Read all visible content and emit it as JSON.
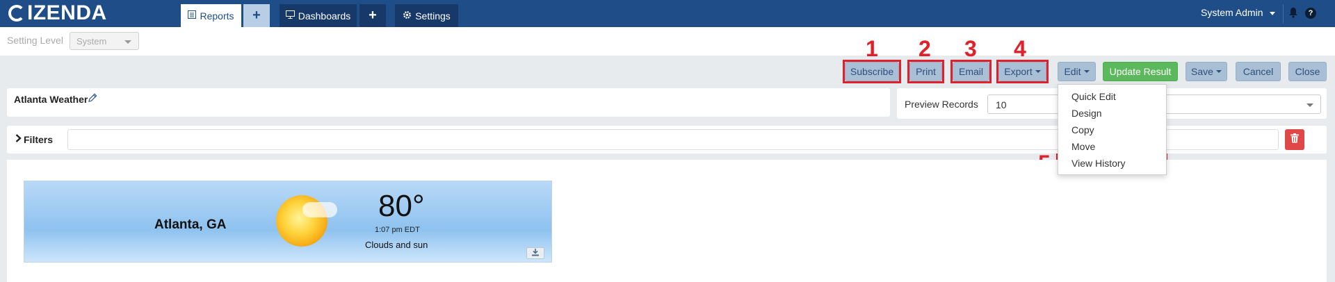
{
  "brand": {
    "logo_text": "IZENDA"
  },
  "nav": {
    "reports_label": "Reports",
    "dashboards_label": "Dashboards",
    "settings_label": "Settings",
    "plus_glyph": "+",
    "user_name": "System Admin",
    "help_glyph": "?"
  },
  "setting_level": {
    "label": "Setting Level",
    "value": "System"
  },
  "toolbar": {
    "subscribe": "Subscribe",
    "print": "Print",
    "email": "Email",
    "export": "Export",
    "edit": "Edit",
    "update_result": "Update Result",
    "save": "Save",
    "cancel": "Cancel",
    "close": "Close"
  },
  "annotations": [
    "1",
    "2",
    "3",
    "4",
    "5"
  ],
  "report": {
    "title": "Atlanta Weather"
  },
  "preview": {
    "label": "Preview Records",
    "value": "10"
  },
  "filters": {
    "label": "Filters"
  },
  "edit_menu": [
    "Quick Edit",
    "Design",
    "Copy",
    "Move",
    "View History"
  ],
  "weather": {
    "city": "Atlanta, GA",
    "temperature": "80°",
    "time": "1:07 pm EDT",
    "condition": "Clouds and sun"
  },
  "colors": {
    "navbar": "#1f4d87",
    "button": "#a9bfd6",
    "primary": "#5cb85c",
    "highlight": "#e0202a",
    "danger": "#e04848"
  },
  "icons": [
    "izenda-logo-icon",
    "reports-icon",
    "dashboards-icon",
    "settings-gear-icon",
    "bell-icon",
    "help-icon",
    "pencil-icon",
    "chevron-right-icon",
    "trash-icon",
    "download-icon",
    "sun-icon"
  ]
}
